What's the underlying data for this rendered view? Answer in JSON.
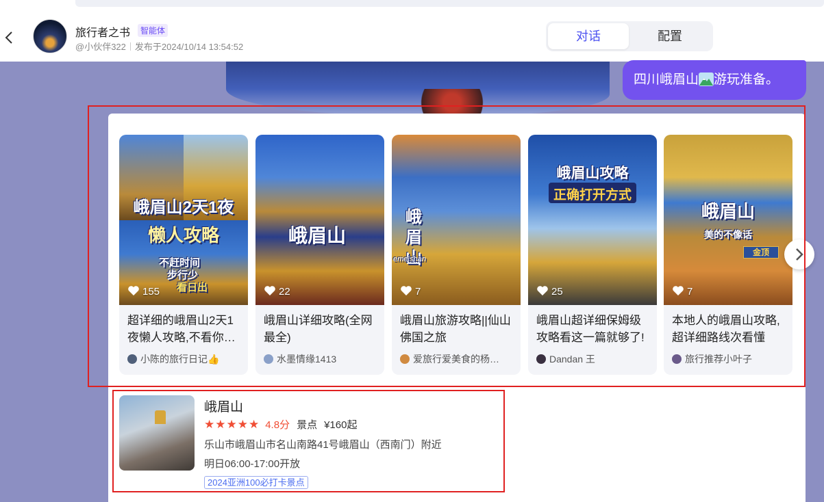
{
  "header": {
    "back_icon": "chevron-left-icon",
    "title": "旅行者之书",
    "badge": "智能体",
    "author": "@小伙伴322",
    "published": "发布于2024/10/14 13:54:52",
    "tabs": [
      {
        "label": "对话",
        "active": true
      },
      {
        "label": "配置",
        "active": false
      }
    ]
  },
  "colors": {
    "accent": "#7352ee",
    "tab_active": "#4a4ff0",
    "highlight_box": "#e02020",
    "rating": "#f04e35"
  },
  "user_message": {
    "text_before": "四川峨眉山",
    "emoji_icon": "mountain-emoji-icon",
    "text_after": "游玩准备。"
  },
  "cards": [
    {
      "overlay_lines": [
        "峨眉山2天1夜",
        "懒人攻略",
        "不赶时间",
        "步行少",
        "看日出"
      ],
      "likes": "155",
      "title": "超详细的峨眉山2天1夜懒人攻略,不看你…",
      "author": "小陈的旅行日记👍"
    },
    {
      "overlay_lines": [
        "峨眉山"
      ],
      "likes": "22",
      "title": "峨眉山详细攻略(全网最全)",
      "author": "水墨情缘1413"
    },
    {
      "overlay_lines": [
        "峨",
        "眉",
        "山",
        "emeishan"
      ],
      "likes": "7",
      "title": "峨眉山旅游攻略||仙山佛国之旅",
      "author": "爱旅行爱美食的杨…"
    },
    {
      "overlay_lines": [
        "峨眉山攻略",
        "正确打开方式"
      ],
      "likes": "25",
      "title": "峨眉山超详细保姆级攻略看这一篇就够了!",
      "author": "Dandan 王"
    },
    {
      "overlay_lines": [
        "峨眉山",
        "美的不像话",
        "金顶"
      ],
      "likes": "7",
      "title": "本地人的峨眉山攻略,超详细路线次看懂",
      "author": "旅行推荐小叶子"
    }
  ],
  "carousel_next_icon": "chevron-right-icon",
  "poi": {
    "name": "峨眉山",
    "stars": "★★★★★",
    "rating": "4.8分",
    "type": "景点",
    "price": "¥160起",
    "address": "乐山市峨眉山市名山南路41号峨眉山（西南门）附近",
    "hours": "明日06:00-17:00开放",
    "tag": "2024亚洲100必打卡景点"
  }
}
